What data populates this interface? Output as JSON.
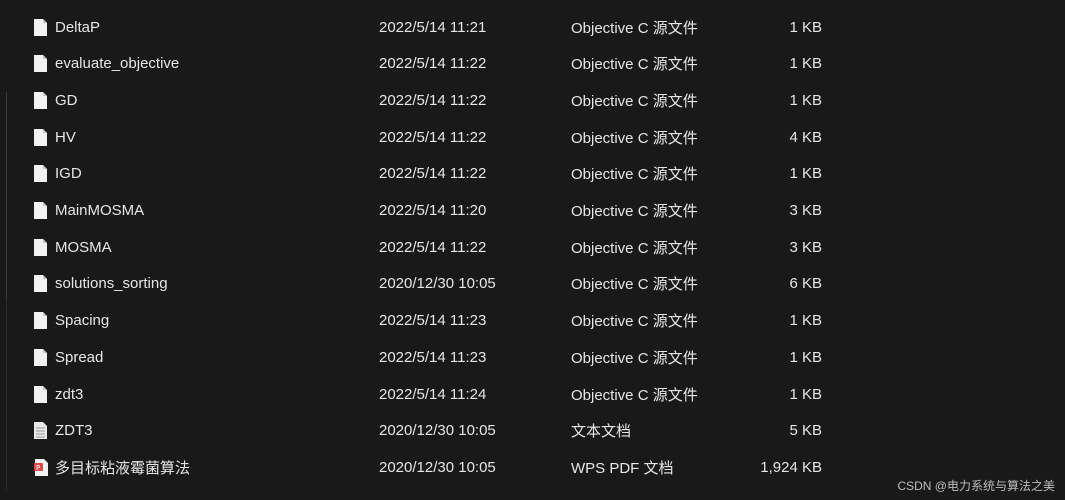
{
  "files": [
    {
      "name": "DeltaP",
      "date": "2022/5/14 11:21",
      "type": "Objective C 源文件",
      "size": "1 KB",
      "icon": "file-icon"
    },
    {
      "name": "evaluate_objective",
      "date": "2022/5/14 11:22",
      "type": "Objective C 源文件",
      "size": "1 KB",
      "icon": "file-icon"
    },
    {
      "name": "GD",
      "date": "2022/5/14 11:22",
      "type": "Objective C 源文件",
      "size": "1 KB",
      "icon": "file-icon"
    },
    {
      "name": "HV",
      "date": "2022/5/14 11:22",
      "type": "Objective C 源文件",
      "size": "4 KB",
      "icon": "file-icon"
    },
    {
      "name": "IGD",
      "date": "2022/5/14 11:22",
      "type": "Objective C 源文件",
      "size": "1 KB",
      "icon": "file-icon"
    },
    {
      "name": "MainMOSMA",
      "date": "2022/5/14 11:20",
      "type": "Objective C 源文件",
      "size": "3 KB",
      "icon": "file-icon"
    },
    {
      "name": "MOSMA",
      "date": "2022/5/14 11:22",
      "type": "Objective C 源文件",
      "size": "3 KB",
      "icon": "file-icon"
    },
    {
      "name": "solutions_sorting",
      "date": "2020/12/30 10:05",
      "type": "Objective C 源文件",
      "size": "6 KB",
      "icon": "file-icon"
    },
    {
      "name": "Spacing",
      "date": "2022/5/14 11:23",
      "type": "Objective C 源文件",
      "size": "1 KB",
      "icon": "file-icon"
    },
    {
      "name": "Spread",
      "date": "2022/5/14 11:23",
      "type": "Objective C 源文件",
      "size": "1 KB",
      "icon": "file-icon"
    },
    {
      "name": "zdt3",
      "date": "2022/5/14 11:24",
      "type": "Objective C 源文件",
      "size": "1 KB",
      "icon": "file-icon"
    },
    {
      "name": "ZDT3",
      "date": "2020/12/30 10:05",
      "type": "文本文档",
      "size": "5 KB",
      "icon": "text-file-icon"
    },
    {
      "name": "多目标粘液霉菌算法",
      "date": "2020/12/30 10:05",
      "type": "WPS PDF 文档",
      "size": "1,924 KB",
      "icon": "pdf-file-icon"
    }
  ],
  "watermark": "CSDN @电力系统与算法之美",
  "colors": {
    "background": "#191919",
    "text": "#e6e6e6",
    "pdf_accent": "#e0484b"
  }
}
